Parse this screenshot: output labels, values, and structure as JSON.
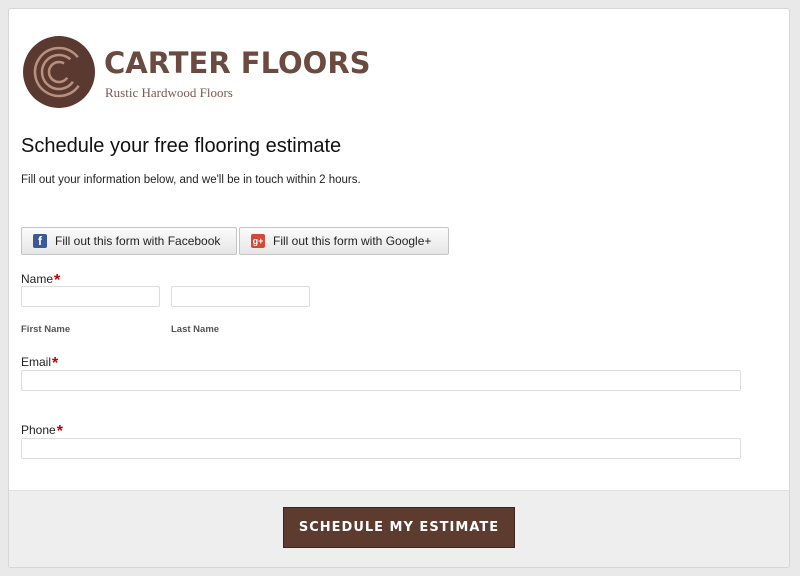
{
  "brand": {
    "logo_letter": "C",
    "name": "CARTER FLOORS",
    "tagline": "Rustic Hardwood Floors"
  },
  "form": {
    "title": "Schedule your free flooring estimate",
    "intro": "Fill out your information below, and we'll be in touch within 2 hours.",
    "social": {
      "facebook_label": "Fill out this form with Facebook",
      "google_label": "Fill out this form with Google+"
    },
    "required_mark": "*",
    "name": {
      "label": "Name",
      "first_value": "",
      "last_value": "",
      "first_sublabel": "First Name",
      "last_sublabel": "Last Name"
    },
    "email": {
      "label": "Email",
      "value": ""
    },
    "phone": {
      "label": "Phone",
      "value": ""
    },
    "submit_label": "SCHEDULE MY ESTIMATE"
  },
  "colors": {
    "brand": "#5e3b2f",
    "required": "#c00000",
    "facebook": "#3b5998",
    "google_plus": "#d34836"
  },
  "icons": {
    "facebook": "facebook-icon",
    "google_plus": "google-plus-icon"
  }
}
